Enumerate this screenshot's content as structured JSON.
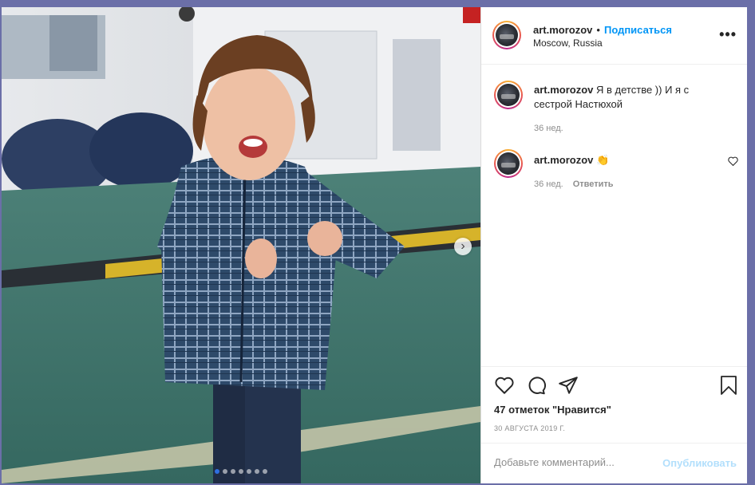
{
  "post": {
    "username": "art.morozov",
    "separator": "•",
    "follow_label": "Подписаться",
    "location": "Moscow, Russia",
    "more_label": "•••"
  },
  "comments": [
    {
      "username": "art.morozov",
      "text": "Я в детстве )) И я с сестрой Настюхой",
      "time": "36 нед."
    },
    {
      "username": "art.morozov",
      "text": "👏",
      "time": "36 нед.",
      "reply_label": "Ответить"
    }
  ],
  "actions": {
    "likes_text": "47 отметок \"Нравится\"",
    "date": "30 АВГУСТА 2019 Г."
  },
  "add_comment": {
    "placeholder": "Добавьте комментарий...",
    "publish_label": "Опубликовать"
  },
  "carousel": {
    "total": 7,
    "current": 1
  },
  "colors": {
    "follow": "#0095f6",
    "publish_disabled": "#b2dffc",
    "active_dot": "#2f6fe0"
  }
}
